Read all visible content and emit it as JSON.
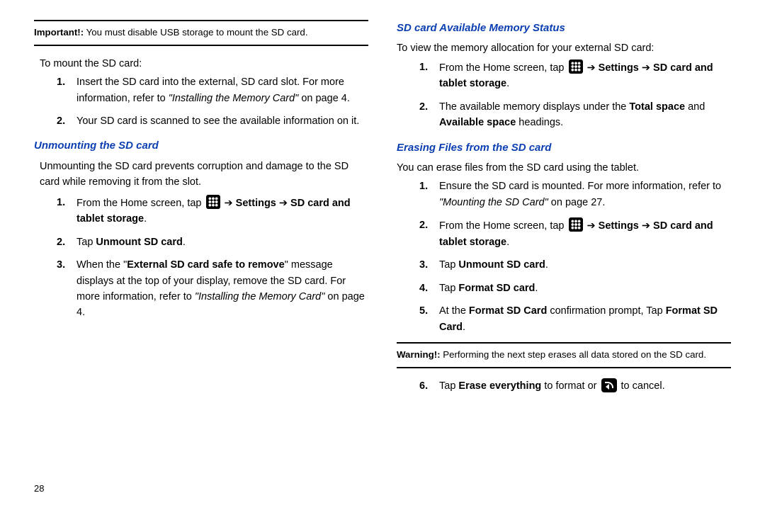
{
  "left": {
    "note_label": "Important!:",
    "note_text": " You must disable USB storage to mount the SD card.",
    "mount_intro": "To mount the SD card:",
    "mount_steps": {
      "s1a": "Insert the SD card into the external, SD card slot. For more information, refer to ",
      "s1b": "\"Installing the Memory Card\"",
      "s1c": "  on page 4.",
      "s2": "Your SD card is scanned to see the available information on it."
    },
    "unmount_heading": "Unmounting the SD card",
    "unmount_intro": "Unmounting the SD card prevents corruption and damage to the SD card while removing it from the slot.",
    "unmount_steps": {
      "s1a": "From the Home screen, tap ",
      "s1_settings": "Settings",
      "s1_sd": "SD card and tablet storage",
      "s1_dot": ".",
      "s2a": "Tap ",
      "s2b": "Unmount SD card",
      "s2c": ".",
      "s3a": "When the \"",
      "s3b": "External SD card safe to remove",
      "s3c": "\" message displays at the top of your display, remove the SD card. For more information, refer to ",
      "s3d": "\"Installing the Memory Card\"",
      "s3e": " on page 4."
    },
    "pagenum": "28"
  },
  "right": {
    "mem_heading": "SD card Available Memory Status",
    "mem_intro": "To view the memory allocation for your external SD card:",
    "mem_steps": {
      "s1a": "From the Home screen, tap ",
      "s1_settings": "Settings",
      "s1_sd": "SD card and tablet storage",
      "s1_dot": ".",
      "s2a": "The available memory displays under the ",
      "s2b": "Total space",
      "s2c": " and ",
      "s2d": "Available space",
      "s2e": " headings."
    },
    "erase_heading": "Erasing Files from the SD card",
    "erase_intro": "You can erase files from the SD card using the tablet.",
    "erase_steps": {
      "s1a": "Ensure the SD card is mounted. For more information, refer to ",
      "s1b": "\"Mounting the SD Card\"",
      "s1c": "  on page 27.",
      "s2a": "From the Home screen, tap ",
      "s2_settings": "Settings",
      "s2_sd": "SD card and tablet storage",
      "s2_dot": ".",
      "s3a": "Tap ",
      "s3b": "Unmount SD card",
      "s3c": ".",
      "s4a": "Tap ",
      "s4b": "Format SD card",
      "s4c": ".",
      "s5a": "At the ",
      "s5b": "Format SD Card",
      "s5c": " confirmation prompt, Tap ",
      "s5d": "Format SD Card",
      "s5e": "."
    },
    "warn_label": "Warning!:",
    "warn_text": " Performing the next step erases all data stored on the SD card.",
    "s6a": "Tap ",
    "s6b": "Erase everything",
    "s6c": " to format or ",
    "s6d": " to cancel."
  }
}
